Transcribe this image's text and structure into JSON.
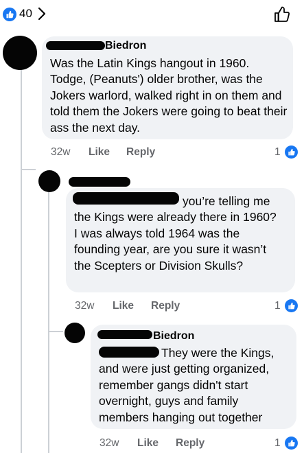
{
  "header": {
    "like_count": "40",
    "like_icon": "thumbs-up-icon",
    "chevron_icon": "chevron-right-icon"
  },
  "comments": [
    {
      "author": "Biedron",
      "text": "Was the Latin Kings hangout in 1960. Todge, (Peanuts') older brother, was the Jokers warlord, walked right in on them and told them the Jokers were going to beat their ass the next day.",
      "time": "32w",
      "like_label": "Like",
      "reply_label": "Reply",
      "reactions": "1"
    },
    {
      "author": "",
      "text": "you’re telling me the Kings were already there in 1960? I was always told 1964 was the founding year, are you sure it wasn’t the Scepters or Division Skulls?",
      "time": "32w",
      "like_label": "Like",
      "reply_label": "Reply",
      "reactions": "1"
    },
    {
      "author": "Biedron",
      "text": "They were the Kings, and were just getting organized, remember gangs didn't start overnight, guys and family members hanging out together",
      "time": "32w",
      "like_label": "Like",
      "reply_label": "Reply",
      "reactions": "1"
    }
  ],
  "colors": {
    "accent": "#1877f2",
    "bubble": "#f0f2f5",
    "meta_text": "#65676b",
    "thread_line": "#ccd0d5"
  }
}
